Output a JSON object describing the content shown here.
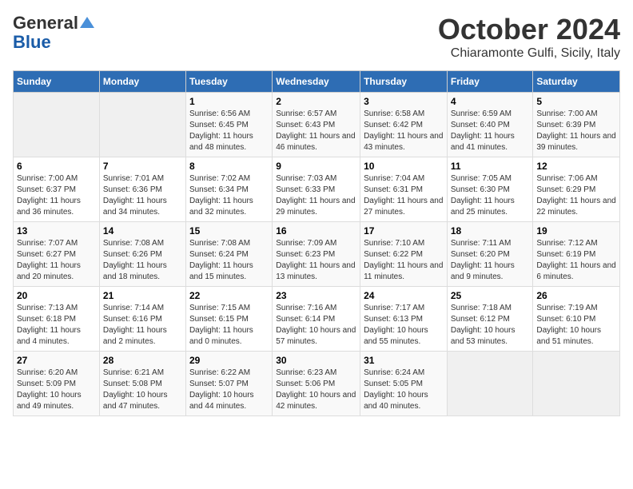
{
  "logo": {
    "line1": "General",
    "triangle": "▲",
    "line2": "Blue"
  },
  "title": "October 2024",
  "location": "Chiaramonte Gulfi, Sicily, Italy",
  "days_of_week": [
    "Sunday",
    "Monday",
    "Tuesday",
    "Wednesday",
    "Thursday",
    "Friday",
    "Saturday"
  ],
  "weeks": [
    [
      {
        "day": "",
        "info": ""
      },
      {
        "day": "",
        "info": ""
      },
      {
        "day": "1",
        "info": "Sunrise: 6:56 AM\nSunset: 6:45 PM\nDaylight: 11 hours and 48 minutes."
      },
      {
        "day": "2",
        "info": "Sunrise: 6:57 AM\nSunset: 6:43 PM\nDaylight: 11 hours and 46 minutes."
      },
      {
        "day": "3",
        "info": "Sunrise: 6:58 AM\nSunset: 6:42 PM\nDaylight: 11 hours and 43 minutes."
      },
      {
        "day": "4",
        "info": "Sunrise: 6:59 AM\nSunset: 6:40 PM\nDaylight: 11 hours and 41 minutes."
      },
      {
        "day": "5",
        "info": "Sunrise: 7:00 AM\nSunset: 6:39 PM\nDaylight: 11 hours and 39 minutes."
      }
    ],
    [
      {
        "day": "6",
        "info": "Sunrise: 7:00 AM\nSunset: 6:37 PM\nDaylight: 11 hours and 36 minutes."
      },
      {
        "day": "7",
        "info": "Sunrise: 7:01 AM\nSunset: 6:36 PM\nDaylight: 11 hours and 34 minutes."
      },
      {
        "day": "8",
        "info": "Sunrise: 7:02 AM\nSunset: 6:34 PM\nDaylight: 11 hours and 32 minutes."
      },
      {
        "day": "9",
        "info": "Sunrise: 7:03 AM\nSunset: 6:33 PM\nDaylight: 11 hours and 29 minutes."
      },
      {
        "day": "10",
        "info": "Sunrise: 7:04 AM\nSunset: 6:31 PM\nDaylight: 11 hours and 27 minutes."
      },
      {
        "day": "11",
        "info": "Sunrise: 7:05 AM\nSunset: 6:30 PM\nDaylight: 11 hours and 25 minutes."
      },
      {
        "day": "12",
        "info": "Sunrise: 7:06 AM\nSunset: 6:29 PM\nDaylight: 11 hours and 22 minutes."
      }
    ],
    [
      {
        "day": "13",
        "info": "Sunrise: 7:07 AM\nSunset: 6:27 PM\nDaylight: 11 hours and 20 minutes."
      },
      {
        "day": "14",
        "info": "Sunrise: 7:08 AM\nSunset: 6:26 PM\nDaylight: 11 hours and 18 minutes."
      },
      {
        "day": "15",
        "info": "Sunrise: 7:08 AM\nSunset: 6:24 PM\nDaylight: 11 hours and 15 minutes."
      },
      {
        "day": "16",
        "info": "Sunrise: 7:09 AM\nSunset: 6:23 PM\nDaylight: 11 hours and 13 minutes."
      },
      {
        "day": "17",
        "info": "Sunrise: 7:10 AM\nSunset: 6:22 PM\nDaylight: 11 hours and 11 minutes."
      },
      {
        "day": "18",
        "info": "Sunrise: 7:11 AM\nSunset: 6:20 PM\nDaylight: 11 hours and 9 minutes."
      },
      {
        "day": "19",
        "info": "Sunrise: 7:12 AM\nSunset: 6:19 PM\nDaylight: 11 hours and 6 minutes."
      }
    ],
    [
      {
        "day": "20",
        "info": "Sunrise: 7:13 AM\nSunset: 6:18 PM\nDaylight: 11 hours and 4 minutes."
      },
      {
        "day": "21",
        "info": "Sunrise: 7:14 AM\nSunset: 6:16 PM\nDaylight: 11 hours and 2 minutes."
      },
      {
        "day": "22",
        "info": "Sunrise: 7:15 AM\nSunset: 6:15 PM\nDaylight: 11 hours and 0 minutes."
      },
      {
        "day": "23",
        "info": "Sunrise: 7:16 AM\nSunset: 6:14 PM\nDaylight: 10 hours and 57 minutes."
      },
      {
        "day": "24",
        "info": "Sunrise: 7:17 AM\nSunset: 6:13 PM\nDaylight: 10 hours and 55 minutes."
      },
      {
        "day": "25",
        "info": "Sunrise: 7:18 AM\nSunset: 6:12 PM\nDaylight: 10 hours and 53 minutes."
      },
      {
        "day": "26",
        "info": "Sunrise: 7:19 AM\nSunset: 6:10 PM\nDaylight: 10 hours and 51 minutes."
      }
    ],
    [
      {
        "day": "27",
        "info": "Sunrise: 6:20 AM\nSunset: 5:09 PM\nDaylight: 10 hours and 49 minutes."
      },
      {
        "day": "28",
        "info": "Sunrise: 6:21 AM\nSunset: 5:08 PM\nDaylight: 10 hours and 47 minutes."
      },
      {
        "day": "29",
        "info": "Sunrise: 6:22 AM\nSunset: 5:07 PM\nDaylight: 10 hours and 44 minutes."
      },
      {
        "day": "30",
        "info": "Sunrise: 6:23 AM\nSunset: 5:06 PM\nDaylight: 10 hours and 42 minutes."
      },
      {
        "day": "31",
        "info": "Sunrise: 6:24 AM\nSunset: 5:05 PM\nDaylight: 10 hours and 40 minutes."
      },
      {
        "day": "",
        "info": ""
      },
      {
        "day": "",
        "info": ""
      }
    ]
  ]
}
